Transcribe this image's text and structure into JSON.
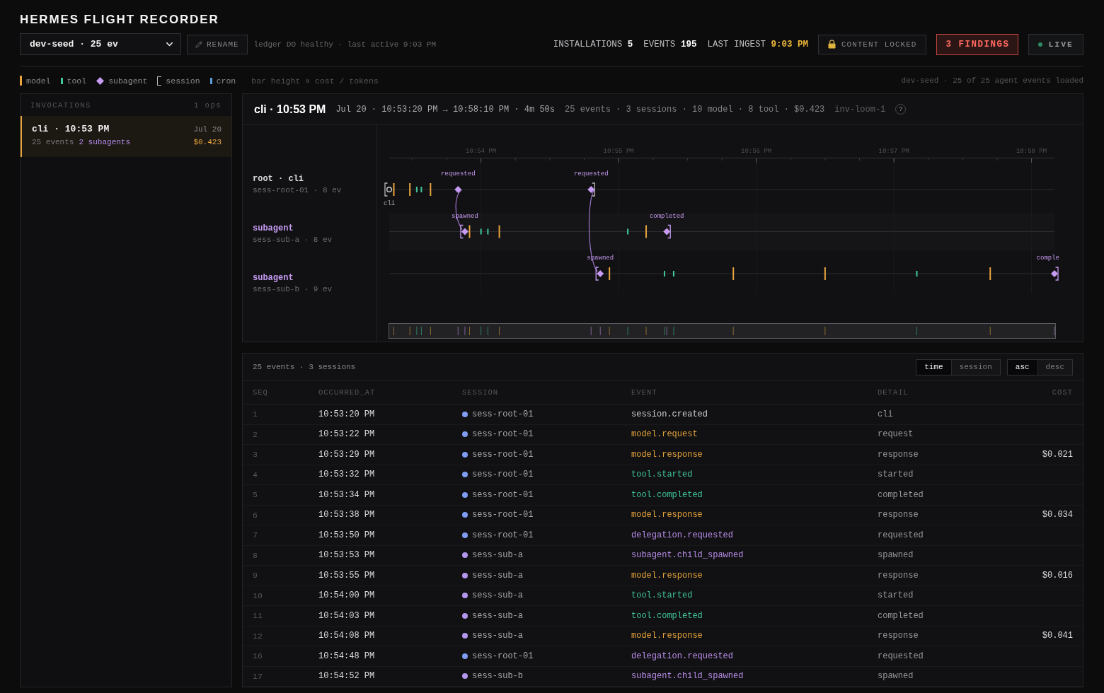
{
  "header": {
    "title": "HERMES FLIGHT RECORDER",
    "ledger_select": {
      "value": "dev-seed · 25 ev"
    },
    "rename_button": {
      "label": "RENAME"
    },
    "status": "ledger DO healthy · last active 9:03 PM",
    "stats": [
      {
        "label": "INSTALLATIONS",
        "value": "5",
        "kind": "plain"
      },
      {
        "label": "EVENTS",
        "value": "195",
        "kind": "plain"
      },
      {
        "label": "LAST INGEST",
        "value": "9:03 PM",
        "kind": "highlight"
      }
    ],
    "content_lock": {
      "label": "CONTENT LOCKED"
    },
    "findings_button": {
      "label": "3 FINDINGS"
    },
    "live_badge": {
      "label": "LIVE",
      "on": true
    }
  },
  "legend": {
    "items": [
      {
        "label": "model",
        "kind": "model",
        "color": "#e8a33d"
      },
      {
        "label": "tool",
        "kind": "tool",
        "color": "#3ec99a"
      },
      {
        "label": "subagent",
        "kind": "subagent",
        "color": "#c79bf2"
      },
      {
        "label": "session",
        "kind": "session",
        "color": "#b8b8b8"
      },
      {
        "label": "cron",
        "kind": "cron",
        "color": "#5b9bd8"
      }
    ],
    "note": "bar height ∝ cost / tokens",
    "summary": "dev-seed · 25 of 25 agent events loaded"
  },
  "sidebar": {
    "title": "INVOCATIONS",
    "count": "1 ops",
    "items": [
      {
        "title": "cli · 10:53 PM",
        "date": "Jul 20",
        "events": "25 events",
        "subagents": "2 subagents",
        "cost": "$0.423",
        "selected": true
      }
    ]
  },
  "invocation": {
    "title": "cli · 10:53 PM",
    "range": "Jul 20 · 10:53:20 PM → 10:58:10 PM · 4m 50s",
    "stats": "25 events · 3 sessions · 10 model · 8 tool · $0.423",
    "id": "inv-loom-1",
    "help": "?"
  },
  "timeline": {
    "time_labels": [
      "10:54 PM",
      "10:55 PM",
      "10:56 PM",
      "10:57 PM",
      "10:58 PM"
    ],
    "lanes": [
      {
        "title": "root · cli",
        "kind": "root",
        "session": "sess-root-01 · 8 ev",
        "annotations": [
          "cli",
          "requested",
          "requested"
        ]
      },
      {
        "title": "subagent",
        "kind": "subagent",
        "session": "sess-sub-a · 8 ev",
        "annotations": [
          "spawned",
          "completed"
        ]
      },
      {
        "title": "subagent",
        "kind": "subagent",
        "session": "sess-sub-b · 9 ev",
        "annotations": [
          "spawned",
          "comple"
        ]
      }
    ]
  },
  "events_table": {
    "summary": "25 events · 3 sessions",
    "group_by": [
      {
        "label": "time",
        "selected": true
      },
      {
        "label": "session",
        "selected": false
      }
    ],
    "order": [
      {
        "label": "asc",
        "selected": true
      },
      {
        "label": "desc",
        "selected": false
      }
    ],
    "columns": [
      "SEQ",
      "OCCURRED_AT",
      "SESSION",
      "EVENT",
      "DETAIL",
      "COST"
    ],
    "rows": [
      {
        "seq": "1",
        "time": "10:53:20 PM",
        "session": "sess-root-01",
        "color": "#7f9df2",
        "event": "session.created",
        "kind": "session",
        "detail": "cli"
      },
      {
        "seq": "2",
        "time": "10:53:22 PM",
        "session": "sess-root-01",
        "color": "#7f9df2",
        "event": "model.request",
        "kind": "model",
        "detail": "request"
      },
      {
        "seq": "3",
        "time": "10:53:29 PM",
        "session": "sess-root-01",
        "color": "#7f9df2",
        "event": "model.response",
        "kind": "model",
        "detail": "response",
        "cost": "$0.021"
      },
      {
        "seq": "4",
        "time": "10:53:32 PM",
        "session": "sess-root-01",
        "color": "#7f9df2",
        "event": "tool.started",
        "kind": "tool",
        "detail": "started"
      },
      {
        "seq": "5",
        "time": "10:53:34 PM",
        "session": "sess-root-01",
        "color": "#7f9df2",
        "event": "tool.completed",
        "kind": "tool",
        "detail": "completed"
      },
      {
        "seq": "6",
        "time": "10:53:38 PM",
        "session": "sess-root-01",
        "color": "#7f9df2",
        "event": "model.response",
        "kind": "model",
        "detail": "response",
        "cost": "$0.034"
      },
      {
        "seq": "7",
        "time": "10:53:50 PM",
        "session": "sess-root-01",
        "color": "#7f9df2",
        "event": "delegation.requested",
        "kind": "subagent",
        "detail": "requested"
      },
      {
        "seq": "8",
        "time": "10:53:53 PM",
        "session": "sess-sub-a",
        "color": "#b596ee",
        "event": "subagent.child_spawned",
        "kind": "subagent",
        "detail": "spawned"
      },
      {
        "seq": "9",
        "time": "10:53:55 PM",
        "session": "sess-sub-a",
        "color": "#b596ee",
        "event": "model.response",
        "kind": "model",
        "detail": "response",
        "cost": "$0.016"
      },
      {
        "seq": "10",
        "time": "10:54:00 PM",
        "session": "sess-sub-a",
        "color": "#b596ee",
        "event": "tool.started",
        "kind": "tool",
        "detail": "started"
      },
      {
        "seq": "11",
        "time": "10:54:03 PM",
        "session": "sess-sub-a",
        "color": "#b596ee",
        "event": "tool.completed",
        "kind": "tool",
        "detail": "completed"
      },
      {
        "seq": "12",
        "time": "10:54:08 PM",
        "session": "sess-sub-a",
        "color": "#b596ee",
        "event": "model.response",
        "kind": "model",
        "detail": "response",
        "cost": "$0.041"
      },
      {
        "seq": "16",
        "time": "10:54:48 PM",
        "session": "sess-root-01",
        "color": "#7f9df2",
        "event": "delegation.requested",
        "kind": "subagent",
        "detail": "requested"
      },
      {
        "seq": "17",
        "time": "10:54:52 PM",
        "session": "sess-sub-b",
        "color": "#b596ee",
        "event": "subagent.child_spawned",
        "kind": "subagent",
        "detail": "spawned"
      }
    ]
  }
}
